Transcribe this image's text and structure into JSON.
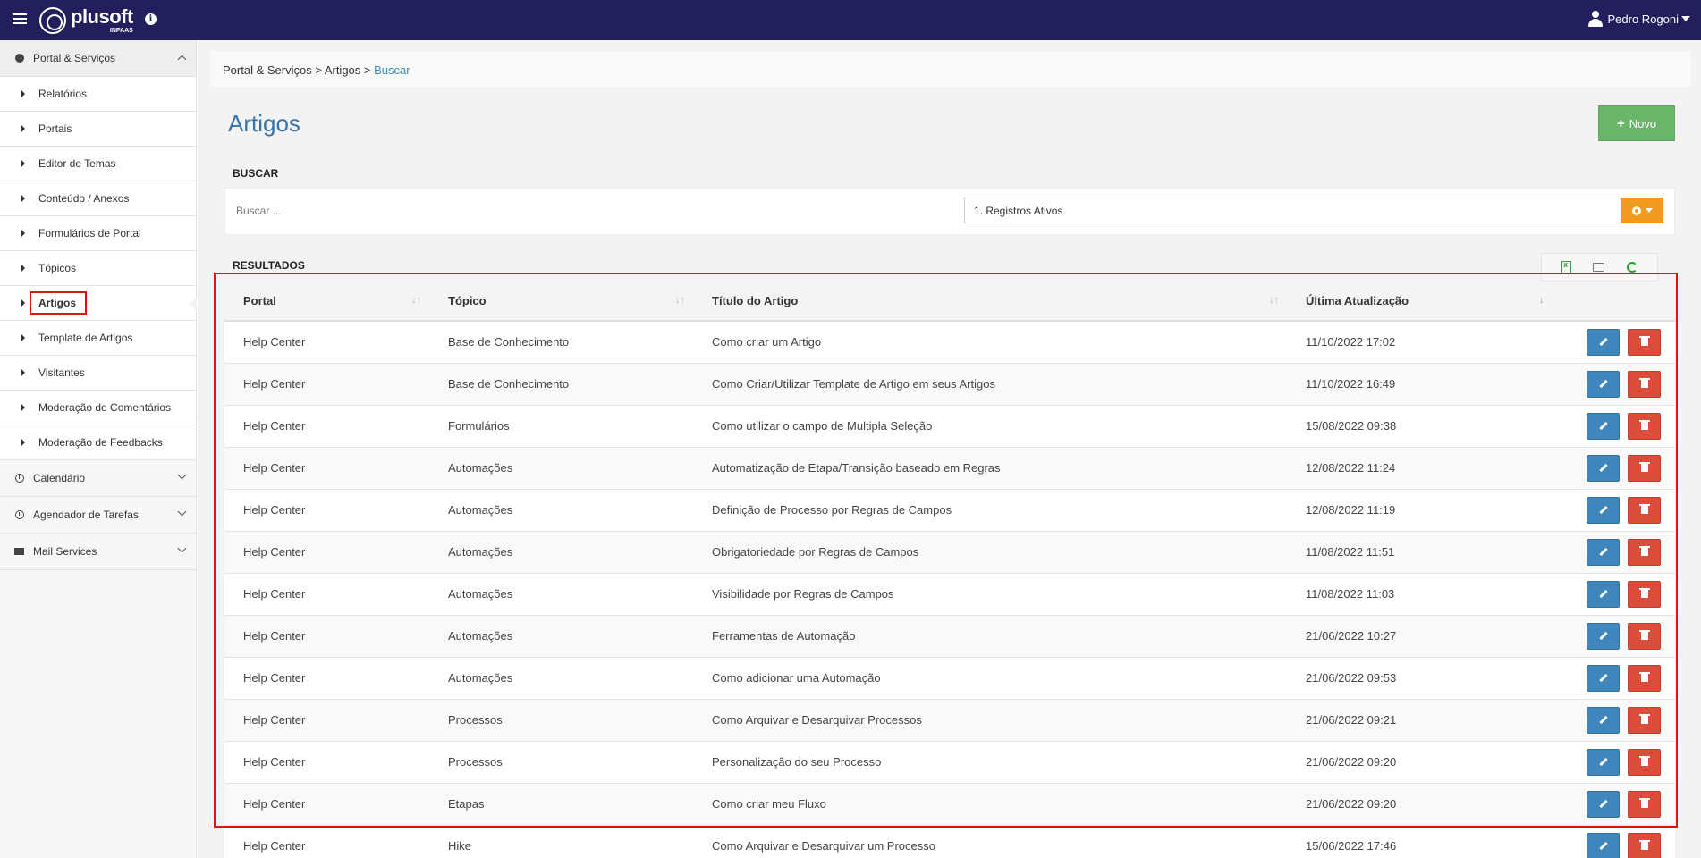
{
  "topbar": {
    "logo_name": "plusoft",
    "logo_sub": "INPAAS",
    "info_icon": "i",
    "user_name": "Pedro Rogoni"
  },
  "sidebar": {
    "portal_group": "Portal & Serviços",
    "items": [
      {
        "label": "Relatórios"
      },
      {
        "label": "Portais"
      },
      {
        "label": "Editor de Temas"
      },
      {
        "label": "Conteúdo / Anexos"
      },
      {
        "label": "Formulários de Portal"
      },
      {
        "label": "Tópicos"
      },
      {
        "label": "Artigos",
        "active": true
      },
      {
        "label": "Template de Artigos"
      },
      {
        "label": "Visitantes"
      },
      {
        "label": "Moderação de Comentários"
      },
      {
        "label": "Moderação de Feedbacks"
      }
    ],
    "calendar_group": "Calendário",
    "scheduler_group": "Agendador de Tarefas",
    "mail_group": "Mail Services"
  },
  "breadcrumb": {
    "part1": "Portal & Serviços",
    "sep1": " > ",
    "part2": "Artigos",
    "sep2": " > ",
    "current": "Buscar"
  },
  "page": {
    "title": "Artigos",
    "new_button": "Novo",
    "search_section": "BUSCAR",
    "search_placeholder": "Buscar ...",
    "filter_value": "1. Registros Ativos",
    "results_section": "RESULTADOS"
  },
  "table": {
    "headers": {
      "portal": "Portal",
      "topic": "Tópico",
      "title": "Título do Artigo",
      "updated": "Última Atualização"
    },
    "rows": [
      [
        "Help Center",
        "Base de Conhecimento",
        "Como criar um Artigo",
        "11/10/2022 17:02"
      ],
      [
        "Help Center",
        "Base de Conhecimento",
        "Como Criar/Utilizar Template de Artigo em seus Artigos",
        "11/10/2022 16:49"
      ],
      [
        "Help Center",
        "Formulários",
        "Como utilizar o campo de Multipla Seleção",
        "15/08/2022 09:38"
      ],
      [
        "Help Center",
        "Automações",
        "Automatização de Etapa/Transição baseado em Regras",
        "12/08/2022 11:24"
      ],
      [
        "Help Center",
        "Automações",
        "Definição de Processo por Regras de Campos",
        "12/08/2022 11:19"
      ],
      [
        "Help Center",
        "Automações",
        "Obrigatoriedade por Regras de Campos",
        "11/08/2022 11:51"
      ],
      [
        "Help Center",
        "Automações",
        "Visibilidade por Regras de Campos",
        "11/08/2022 11:03"
      ],
      [
        "Help Center",
        "Automações",
        "Ferramentas de Automação",
        "21/06/2022 10:27"
      ],
      [
        "Help Center",
        "Automações",
        "Como adicionar uma Automação",
        "21/06/2022 09:53"
      ],
      [
        "Help Center",
        "Processos",
        "Como Arquivar e Desarquivar Processos",
        "21/06/2022 09:21"
      ],
      [
        "Help Center",
        "Processos",
        "Personalização do seu Processo",
        "21/06/2022 09:20"
      ],
      [
        "Help Center",
        "Etapas",
        "Como criar meu Fluxo",
        "21/06/2022 09:20"
      ],
      [
        "Help Center",
        "Hike",
        "Como Arquivar e Desarquivar um Processo",
        "15/06/2022 17:46"
      ]
    ]
  },
  "colors": {
    "topbar": "#231f5c",
    "accent_blue": "#3a73a8",
    "edit_button": "#3e86bb",
    "delete_button": "#d94d3a",
    "new_button": "#6bb56b",
    "gear_button": "#f09a1f",
    "highlight": "#e01414"
  }
}
